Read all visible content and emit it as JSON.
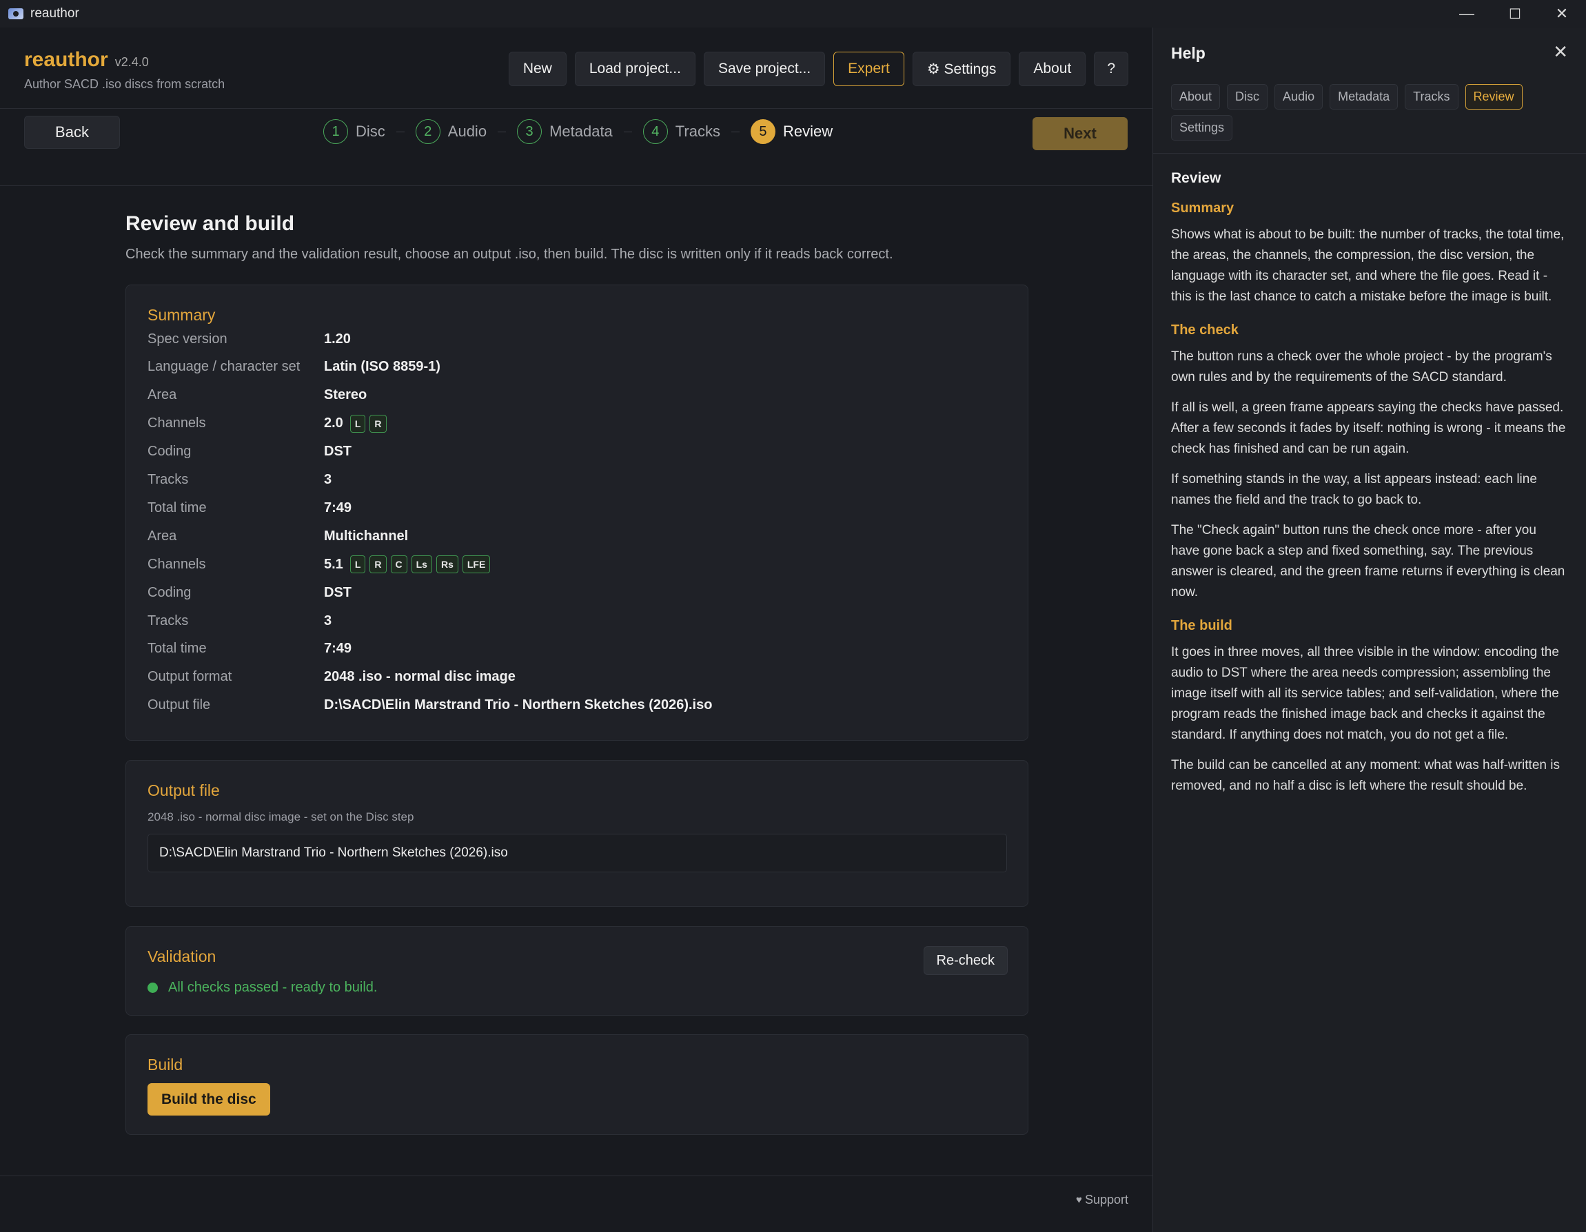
{
  "window": {
    "title": "reauthor",
    "minimize": "—",
    "maximize": "☐",
    "close": "✕"
  },
  "brand": {
    "name": "reauthor",
    "version": "v2.4.0",
    "tagline": "Author SACD .iso discs from scratch"
  },
  "header_buttons": [
    "New",
    "Load project...",
    "Save project...",
    "Expert",
    "⚙ Settings",
    "About",
    "?"
  ],
  "stepbar": {
    "back": "Back",
    "next": "Next",
    "steps": [
      {
        "num": "1",
        "label": "Disc"
      },
      {
        "num": "2",
        "label": "Audio"
      },
      {
        "num": "3",
        "label": "Metadata"
      },
      {
        "num": "4",
        "label": "Tracks"
      },
      {
        "num": "5",
        "label": "Review"
      }
    ]
  },
  "page": {
    "title": "Review and build",
    "lead": "Check the summary and the validation result, choose an output .iso, then build. The disc is written only if it reads back correct."
  },
  "summary": {
    "title": "Summary",
    "rows": [
      {
        "k": "Spec version",
        "v": "1.20"
      },
      {
        "k": "Language / character set",
        "v": "Latin (ISO 8859-1)"
      },
      {
        "k": "Area",
        "v": "Stereo"
      },
      {
        "k": "Channels",
        "v": "2.0",
        "chips": [
          "L",
          "R"
        ]
      },
      {
        "k": "Coding",
        "v": "DST"
      },
      {
        "k": "Tracks",
        "v": "3"
      },
      {
        "k": "Total time",
        "v": "7:49"
      },
      {
        "k": "Area",
        "v": "Multichannel"
      },
      {
        "k": "Channels",
        "v": "5.1",
        "chips": [
          "L",
          "R",
          "C",
          "Ls",
          "Rs",
          "LFE"
        ]
      },
      {
        "k": "Coding",
        "v": "DST"
      },
      {
        "k": "Tracks",
        "v": "3"
      },
      {
        "k": "Total time",
        "v": "7:49"
      },
      {
        "k": "Output format",
        "v": "2048 .iso - normal disc image"
      },
      {
        "k": "Output file",
        "v": "D:\\SACD\\Elin Marstrand Trio - Northern Sketches (2026).iso"
      }
    ]
  },
  "output_file": {
    "title": "Output file",
    "hint": "2048 .iso - normal disc image - set on the Disc step",
    "value": "D:\\SACD\\Elin Marstrand Trio - Northern Sketches (2026).iso"
  },
  "validation": {
    "title": "Validation",
    "recheck": "Re-check",
    "status": "All checks passed - ready to build."
  },
  "build": {
    "title": "Build",
    "button": "Build the disc"
  },
  "footer": {
    "support": "Support",
    "support_icon": "heart-icon"
  },
  "help": {
    "title": "Help",
    "close": "✕",
    "tabs": [
      "About",
      "Disc",
      "Audio",
      "Metadata",
      "Tracks",
      "Review",
      "Settings"
    ],
    "active_tab": "Review",
    "section_title": "Review",
    "sections": [
      {
        "heading": "Summary",
        "paras": [
          "Shows what is about to be built: the number of tracks, the total time, the areas, the channels, the compression, the disc version, the language with its character set, and where the file goes. Read it - this is the last chance to catch a mistake before the image is built."
        ]
      },
      {
        "heading": "The check",
        "paras": [
          "The button runs a check over the whole project - by the program's own rules and by the requirements of the SACD standard.",
          "If all is well, a green frame appears saying the checks have passed. After a few seconds it fades by itself: nothing is wrong - it means the check has finished and can be run again.",
          "If something stands in the way, a list appears instead: each line names the field and the track to go back to.",
          "The \"Check again\" button runs the check once more - after you have gone back a step and fixed something, say. The previous answer is cleared, and the green frame returns if everything is clean now."
        ]
      },
      {
        "heading": "The build",
        "paras": [
          "It goes in three moves, all three visible in the window: encoding the audio to DST where the area needs compression; assembling the image itself with all its service tables; and self-validation, where the program reads the finished image back and checks it against the standard. If anything does not match, you do not get a file.",
          "The build can be cancelled at any moment: what was half-written is removed, and no half a disc is left where the result should be."
        ]
      }
    ]
  },
  "colors": {
    "accent": "#e3a63c",
    "success": "#4bb35d",
    "background": "#181a1f",
    "panel": "#1f2127"
  }
}
